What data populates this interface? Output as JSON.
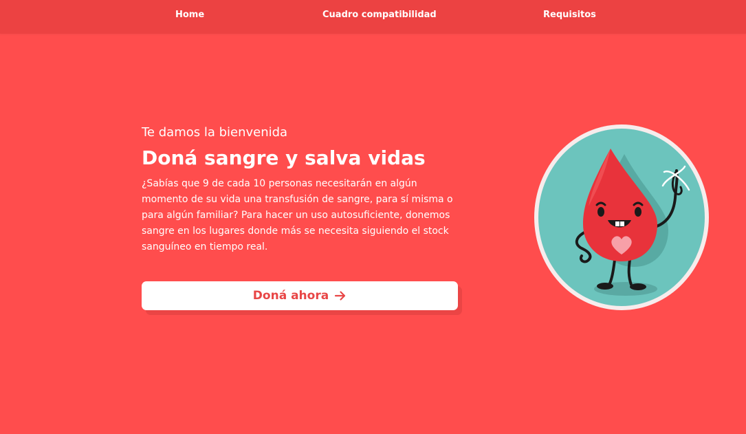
{
  "nav": {
    "items": [
      {
        "label": "Home"
      },
      {
        "label": "Cuadro compatibilidad"
      },
      {
        "label": "Requisitos"
      }
    ]
  },
  "hero": {
    "welcome": "Te damos la bienvenida",
    "title": "Doná sangre y salva vidas",
    "text": "¿Sabías que 9 de cada 10 personas necesitarán en algún momento de su vida una transfusión de sangre, para sí misma o para algún familiar? Para hacer un uso autosuficiente, donemos sangre en los lugares donde más se necesita siguiendo el stock sanguíneo en tiempo real.",
    "cta_label": "Doná ahora",
    "cta_icon": "arrow-right-icon"
  },
  "illustration": {
    "icon": "blood-drop-mascot-icon"
  },
  "colors": {
    "background": "#ff4d4d",
    "navbar": "#ec4242",
    "cta_text": "#e84646",
    "circle": "#6cc4bd",
    "drop": "#e8333b"
  }
}
